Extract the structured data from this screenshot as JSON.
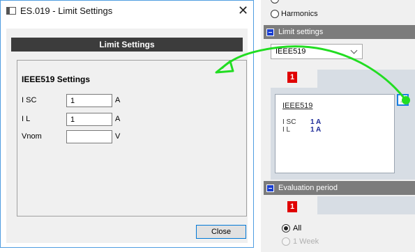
{
  "dialog": {
    "title": "ES.019 - Limit Settings",
    "header": "Limit Settings",
    "group_title": "IEEE519 Settings",
    "fields": [
      {
        "label": "I SC",
        "value": "1",
        "unit": "A"
      },
      {
        "label": "I L",
        "value": "1",
        "unit": "A"
      },
      {
        "label": "Vnom",
        "value": "",
        "unit": "V"
      }
    ],
    "close_label": "Close",
    "close_glyph": "✕"
  },
  "right_panel": {
    "harmonics_label": "Harmonics",
    "limit_settings_header": "Limit settings",
    "limit_standard_value": "IEEE519",
    "tab_number": "1",
    "card": {
      "title": "IEEE519",
      "rows": [
        {
          "label": "I SC",
          "value": "1 A"
        },
        {
          "label": "I L",
          "value": "1 A"
        }
      ],
      "edit_glyph": "..."
    },
    "evaluation_header": "Evaluation period",
    "eval_tab_number": "1",
    "eval_options": [
      {
        "label": "All",
        "checked": true,
        "enabled": true
      },
      {
        "label": "1 Week",
        "checked": false,
        "enabled": false
      }
    ]
  },
  "colors": {
    "section_header": "#7c7c7c",
    "dialog_header": "#3c3c3c",
    "badge": "#e00000",
    "value_text": "#1c2a98",
    "annotation_arrow": "#22dd22"
  }
}
